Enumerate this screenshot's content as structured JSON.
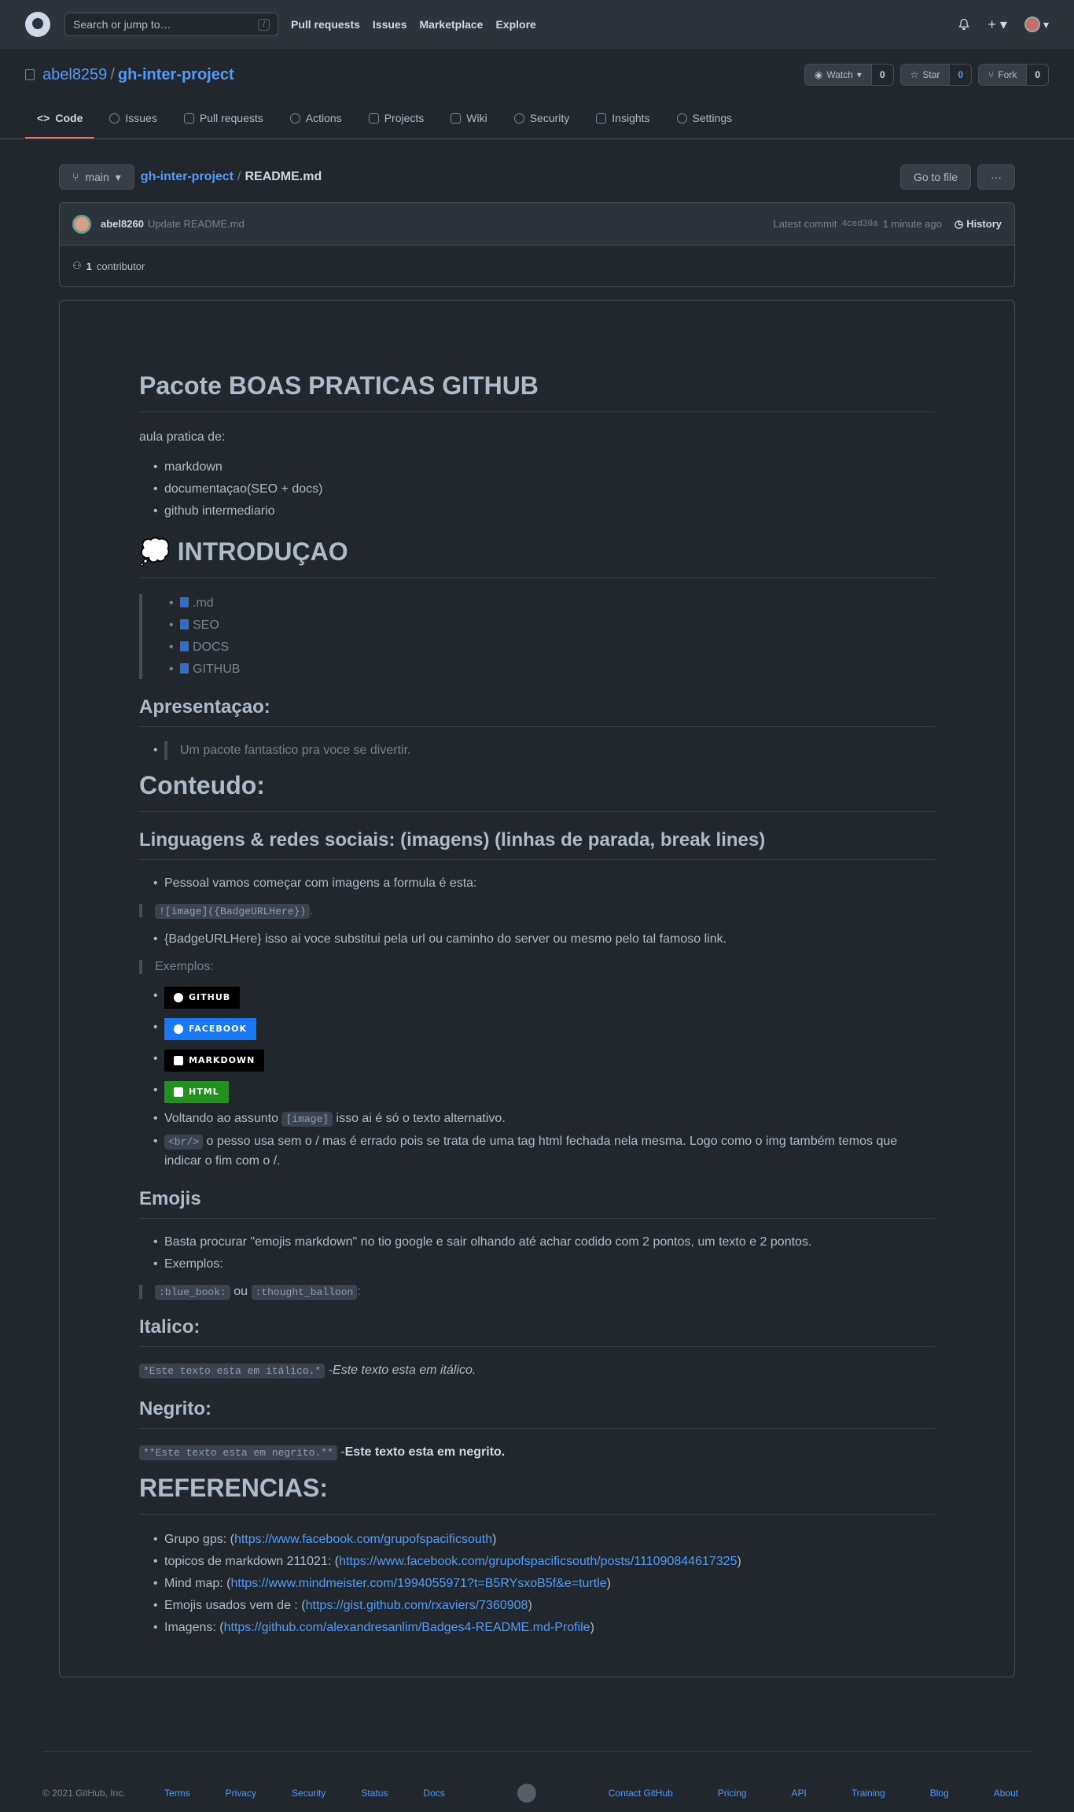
{
  "header": {
    "search_placeholder": "Search or jump to…",
    "search_key": "/",
    "nav": [
      "Pull requests",
      "Issues",
      "Marketplace",
      "Explore"
    ]
  },
  "repo": {
    "owner": "abel8259",
    "sep": "/",
    "name": "gh-inter-project",
    "watch": "Watch",
    "watch_count": "0",
    "star": "Star",
    "star_count": "0",
    "fork": "Fork",
    "fork_count": "0"
  },
  "tabs": [
    "Code",
    "Issues",
    "Pull requests",
    "Actions",
    "Projects",
    "Wiki",
    "Security",
    "Insights",
    "Settings"
  ],
  "file": {
    "branch": "main",
    "repo": "gh-inter-project",
    "slash": "/",
    "filename": "README.md",
    "goto": "Go to file",
    "more": "···"
  },
  "commit": {
    "user": "abel8260",
    "message": "Update README.md",
    "latest": "Latest commit",
    "sha": "4ced30a",
    "time": "1 minute ago",
    "history": "History",
    "contrib_count": "1",
    "contrib_label": "contributor"
  },
  "readme": {
    "title": "Pacote BOAS PRATICAS GITHUB",
    "intro": "aula pratica de:",
    "topics": [
      "markdown",
      "documentaçao(SEO + docs)",
      "github intermediario"
    ],
    "h_intro": "💭 INTRODUÇAO",
    "intro_items": [
      ".md",
      "SEO",
      "DOCS",
      "GITHUB"
    ],
    "h_apres": "Apresentaçao:",
    "apres": "Um pacote fantastico pra voce se divertir.",
    "h_conteudo": "Conteudo:",
    "h_lang": "Linguagens & redes sociais: (imagens) (linhas de parada, break lines)",
    "lang1": "Pessoal vamos começar com imagens a formula é esta:",
    "lang_code": "![image]({BadgeURLHere})",
    "lang_code_after": ".",
    "lang2": "{BadgeURLHere} isso ai voce substitui pela url ou caminho do server ou mesmo pelo tal famoso link.",
    "exemplos": "Exemplos:",
    "badges": [
      {
        "label": "GITHUB",
        "color": "#000000"
      },
      {
        "label": "FACEBOOK",
        "color": "#1877f2"
      },
      {
        "label": "MARKDOWN",
        "color": "#000000"
      },
      {
        "label": "HTML",
        "color": "#239120"
      }
    ],
    "alt_a": "Voltando ao assunto",
    "alt_code": "[image]",
    "alt_b": "isso ai é só o texto alternativo.",
    "br_code": "<br/>",
    "br_text": "o pesso usa sem o / mas é errado pois se trata de uma tag html fechada nela mesma. Logo como o img também temos que indicar o fim com o /.",
    "h_emojis": "Emojis",
    "emoji1": "Basta procurar \"emojis markdown\" no tio google e sair olhando até achar codido com 2 pontos, um texto e 2 pontos.",
    "emoji2": "Exemplos:",
    "emoji_code1": ":blue_book:",
    "emoji_ou": "ou",
    "emoji_code2": ":thought_balloon",
    "emoji_end": ":",
    "h_italico": "Italico:",
    "ital_code": "*Este texto esta em itálico.*",
    "ital_dash": " -",
    "ital_text": "Este texto esta em itálico.",
    "h_negrito": "Negrito:",
    "bold_code": "**Este texto esta em negrito.**",
    "bold_dash": " -",
    "bold_text": "Este texto esta em negrito.",
    "h_ref": "REFERENCIAS:",
    "refs": [
      {
        "label": "Grupo gps: (",
        "url": "https://www.facebook.com/grupofspacificsouth",
        "end": ")"
      },
      {
        "label": "topicos de markdown 211021: (",
        "url": "https://www.facebook.com/grupofspacificsouth/posts/111090844617325",
        "end": ")"
      },
      {
        "label": "Mind map: (",
        "url": "https://www.mindmeister.com/1994055971?t=B5RYsxoB5f&e=turtle",
        "end": ")"
      },
      {
        "label": "Emojis usados vem de : (",
        "url": "https://gist.github.com/rxaviers/7360908",
        "end": ")"
      },
      {
        "label": "Imagens: (",
        "url": "https://github.com/alexandresanlim/Badges4-README.md-Profile",
        "end": ")"
      }
    ]
  },
  "footer": {
    "copy": "© 2021 GitHub, Inc.",
    "left": [
      "Terms",
      "Privacy",
      "Security",
      "Status",
      "Docs"
    ],
    "right": [
      "Contact GitHub",
      "Pricing",
      "API",
      "Training",
      "Blog",
      "About"
    ]
  }
}
